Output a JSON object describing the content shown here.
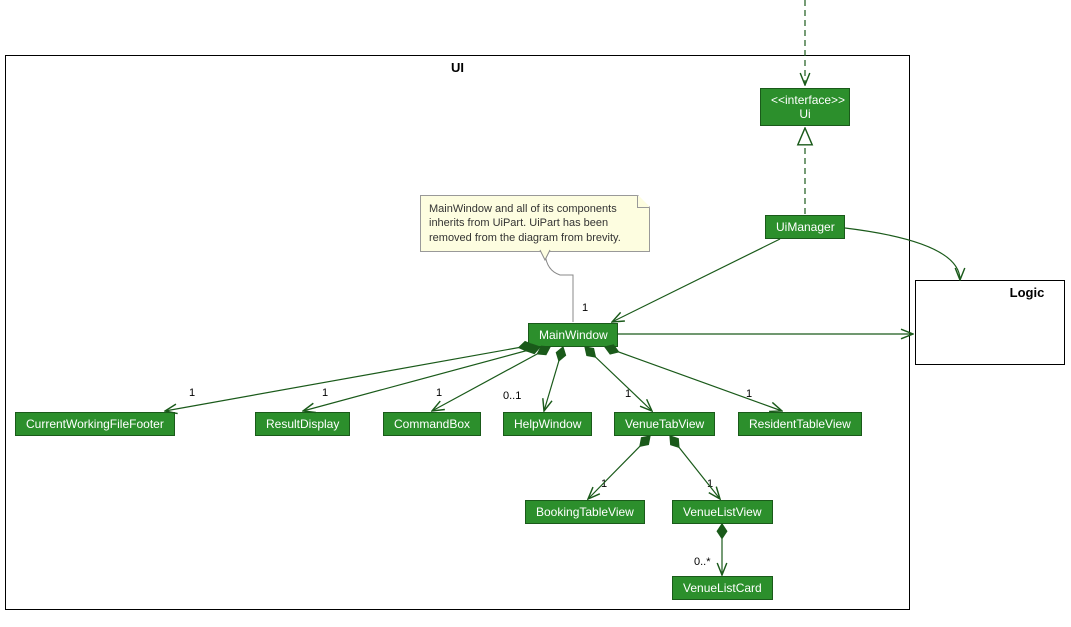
{
  "packages": {
    "ui": {
      "title": "UI"
    },
    "logic": {
      "title": "Logic"
    }
  },
  "classes": {
    "ui_interface": {
      "stereo": "<<interface>>",
      "name": "Ui"
    },
    "ui_manager": {
      "name": "UiManager"
    },
    "main_window": {
      "name": "MainWindow"
    },
    "cwff": {
      "name": "CurrentWorkingFileFooter"
    },
    "result_display": {
      "name": "ResultDisplay"
    },
    "command_box": {
      "name": "CommandBox"
    },
    "help_window": {
      "name": "HelpWindow"
    },
    "venue_tab_view": {
      "name": "VenueTabView"
    },
    "resident_table_view": {
      "name": "ResidentTableView"
    },
    "booking_table_view": {
      "name": "BookingTableView"
    },
    "venue_list_view": {
      "name": "VenueListView"
    },
    "venue_list_card": {
      "name": "VenueListCard"
    }
  },
  "note": {
    "text": "MainWindow and all of its components inherits from UiPart. UiPart has been removed from the diagram from brevity."
  },
  "multiplicities": {
    "uimgr_mw": "1",
    "mw_cwff": "1",
    "mw_rd": "1",
    "mw_cb": "1",
    "mw_hw": "0..1",
    "mw_vtv": "1",
    "mw_rtv": "1",
    "vtv_btv": "1",
    "vtv_vlv": "1",
    "vlv_vlc": "0..*"
  }
}
